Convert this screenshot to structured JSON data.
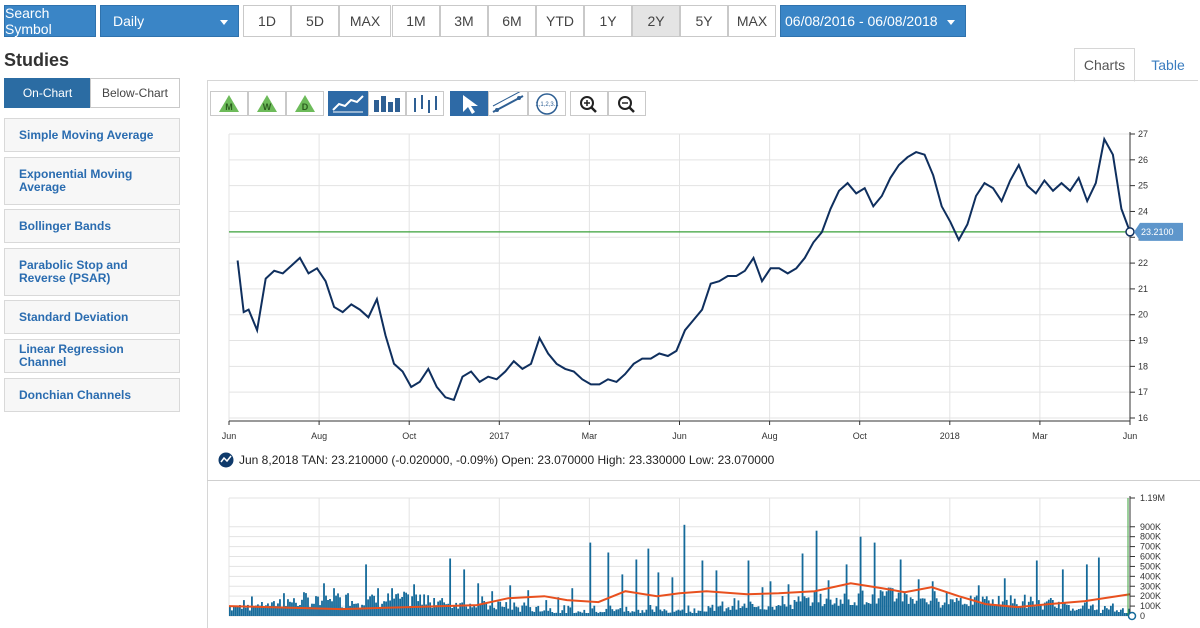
{
  "toolbar": {
    "search_label": "Search Symbol",
    "interval_label": "Daily",
    "intraday_ranges": [
      "1D",
      "5D",
      "MAX"
    ],
    "ranges": [
      "1M",
      "3M",
      "6M",
      "YTD",
      "1Y",
      "2Y",
      "5Y",
      "MAX"
    ],
    "selected_range": "2Y",
    "date_range": "06/08/2016 - 06/08/2018"
  },
  "studies": {
    "title": "Studies",
    "tabs": [
      "On-Chart",
      "Below-Chart"
    ],
    "active_tab": "On-Chart",
    "items": [
      "Simple Moving Average",
      "Exponential Moving Average",
      "Bollinger Bands",
      "Parabolic Stop and Reverse (PSAR)",
      "Standard Deviation",
      "Linear Regression Channel",
      "Donchian Channels"
    ]
  },
  "view_tabs": [
    "Charts",
    "Table"
  ],
  "active_view": "Charts",
  "chart_tools": {
    "periods": [
      "M",
      "W",
      "D"
    ],
    "chart_types": [
      "line-chart-icon",
      "bar-chart-icon",
      "ohlc-chart-icon"
    ],
    "drawing": [
      "pointer-icon",
      "trendline-icon",
      "fibonacci-icon"
    ],
    "fib_label": "1,1,2,3...",
    "zoom": [
      "zoom-in-icon",
      "zoom-out-icon"
    ]
  },
  "colors": {
    "accent": "#3a85c6",
    "price_line": "#0f2f5e",
    "last_price_line": "#3aa13a",
    "volume_bar": "#156a9a",
    "volume_avg": "#e8501e",
    "price_badge": "#5e96cb"
  },
  "info_bar": "Jun 8,2018 TAN: 23.210000 (-0.020000, -0.09%) Open: 23.070000 High: 23.330000 Low: 23.070000",
  "last_price_label": "23.2100",
  "chart_data": [
    {
      "type": "line",
      "title": "",
      "series": [
        {
          "name": "TAN",
          "x": [
            "2016-06-08",
            "2016-06-13",
            "2016-06-17",
            "2016-06-24",
            "2016-07-01",
            "2016-07-08",
            "2016-07-15",
            "2016-07-22",
            "2016-07-29",
            "2016-08-05",
            "2016-08-12",
            "2016-08-19",
            "2016-08-26",
            "2016-09-02",
            "2016-09-09",
            "2016-09-16",
            "2016-09-23",
            "2016-09-30",
            "2016-10-07",
            "2016-10-14",
            "2016-10-21",
            "2016-10-28",
            "2016-11-04",
            "2016-11-11",
            "2016-11-18",
            "2016-11-25",
            "2016-12-02",
            "2016-12-09",
            "2016-12-16",
            "2016-12-23",
            "2016-12-30",
            "2017-01-06",
            "2017-01-13",
            "2017-01-20",
            "2017-01-27",
            "2017-02-03",
            "2017-02-10",
            "2017-02-17",
            "2017-02-24",
            "2017-03-03",
            "2017-03-10",
            "2017-03-17",
            "2017-03-24",
            "2017-03-31",
            "2017-04-07",
            "2017-04-14",
            "2017-04-21",
            "2017-04-28",
            "2017-05-05",
            "2017-05-12",
            "2017-05-19",
            "2017-05-26",
            "2017-06-02",
            "2017-06-09",
            "2017-06-16",
            "2017-06-23",
            "2017-06-30",
            "2017-07-07",
            "2017-07-14",
            "2017-07-21",
            "2017-07-28",
            "2017-08-04",
            "2017-08-11",
            "2017-08-18",
            "2017-08-25",
            "2017-09-01",
            "2017-09-08",
            "2017-09-15",
            "2017-09-22",
            "2017-09-29",
            "2017-10-06",
            "2017-10-13",
            "2017-10-20",
            "2017-10-27",
            "2017-11-03",
            "2017-11-10",
            "2017-11-17",
            "2017-11-24",
            "2017-12-01",
            "2017-12-08",
            "2017-12-15",
            "2017-12-22",
            "2017-12-29",
            "2018-01-05",
            "2018-01-12",
            "2018-01-19",
            "2018-01-26",
            "2018-02-02",
            "2018-02-09",
            "2018-02-16",
            "2018-02-23",
            "2018-03-02",
            "2018-03-09",
            "2018-03-16",
            "2018-03-23",
            "2018-03-30",
            "2018-04-06",
            "2018-04-13",
            "2018-04-20",
            "2018-04-27",
            "2018-05-04",
            "2018-05-11",
            "2018-05-18",
            "2018-05-25",
            "2018-06-01",
            "2018-06-08"
          ],
          "values": [
            22.1,
            20.1,
            20.2,
            19.4,
            21.4,
            21.7,
            21.6,
            21.9,
            22.2,
            21.6,
            21.8,
            21.3,
            20.3,
            20.1,
            20.4,
            20.2,
            19.9,
            20.6,
            19.2,
            18.1,
            17.8,
            17.2,
            17.4,
            17.9,
            17.2,
            16.8,
            16.7,
            17.6,
            17.8,
            17.4,
            17.6,
            17.5,
            17.8,
            18.2,
            17.9,
            18.1,
            19.1,
            18.5,
            18.1,
            17.9,
            17.8,
            17.5,
            17.3,
            17.3,
            17.5,
            17.4,
            17.7,
            18.1,
            18.3,
            18.3,
            18.5,
            18.4,
            18.6,
            19.4,
            19.8,
            20.2,
            21.2,
            21.3,
            21.5,
            21.5,
            21.7,
            22.2,
            21.3,
            21.8,
            21.8,
            21.6,
            21.8,
            22.2,
            22.8,
            23.2,
            24.1,
            24.8,
            25.1,
            24.7,
            24.9,
            24.2,
            24.6,
            25.3,
            25.8,
            26.1,
            26.3,
            26.2,
            25.4,
            24.2,
            23.6,
            22.9,
            23.5,
            24.6,
            25.1,
            24.9,
            24.4,
            25.2,
            25.8,
            25.0,
            24.7,
            25.2,
            24.8,
            25.1,
            24.8,
            25.3,
            24.4,
            25.1,
            26.8,
            26.2,
            24.1,
            23.21
          ]
        }
      ],
      "x_ticks": [
        "Jun",
        "Aug",
        "Oct",
        "2017",
        "Mar",
        "Jun",
        "Aug",
        "Oct",
        "2018",
        "Mar",
        "Jun"
      ],
      "y_ticks": [
        "16",
        "17",
        "18",
        "19",
        "20",
        "21",
        "22",
        "23",
        "24",
        "25",
        "26",
        "27"
      ],
      "ylim": [
        16,
        27
      ],
      "last_value": 23.21,
      "grid": true
    },
    {
      "type": "bar",
      "title": "",
      "series": [
        {
          "name": "Volume",
          "values": []
        },
        {
          "name": "Volume average",
          "values": []
        }
      ],
      "y_ticks": [
        "0",
        "100K",
        "200K",
        "300K",
        "400K",
        "500K",
        "600K",
        "700K",
        "800K",
        "900K",
        "1.19M"
      ],
      "ylim": [
        0,
        1190000
      ],
      "grid": true,
      "volume_spikes": [
        [
          0.03,
          160000
        ],
        [
          0.12,
          230000
        ],
        [
          0.21,
          330000
        ],
        [
          0.23,
          280000
        ],
        [
          0.26,
          230000
        ],
        [
          0.3,
          520000
        ],
        [
          0.33,
          280000
        ],
        [
          0.36,
          280000
        ],
        [
          0.41,
          320000
        ],
        [
          0.44,
          210000
        ],
        [
          0.49,
          580000
        ],
        [
          0.52,
          470000
        ],
        [
          0.55,
          330000
        ],
        [
          0.58,
          250000
        ],
        [
          0.62,
          310000
        ],
        [
          0.66,
          260000
        ],
        [
          0.7,
          160000
        ],
        [
          0.73,
          190000
        ],
        [
          0.76,
          280000
        ],
        [
          0.8,
          740000
        ],
        [
          0.84,
          640000
        ],
        [
          0.87,
          420000
        ],
        [
          0.9,
          570000
        ],
        [
          0.93,
          680000
        ],
        [
          0.95,
          440000
        ],
        [
          0.98,
          390000
        ],
        [
          1.01,
          920000
        ],
        [
          1.05,
          560000
        ],
        [
          1.08,
          460000
        ],
        [
          1.12,
          180000
        ],
        [
          1.15,
          560000
        ],
        [
          1.18,
          290000
        ],
        [
          1.2,
          350000
        ],
        [
          1.24,
          320000
        ],
        [
          1.27,
          630000
        ],
        [
          1.3,
          860000
        ],
        [
          1.33,
          360000
        ],
        [
          1.37,
          520000
        ],
        [
          1.4,
          800000
        ],
        [
          1.43,
          740000
        ],
        [
          1.47,
          280000
        ],
        [
          1.49,
          570000
        ],
        [
          1.53,
          370000
        ],
        [
          1.56,
          350000
        ],
        [
          1.61,
          140000
        ],
        [
          1.66,
          310000
        ],
        [
          1.72,
          380000
        ],
        [
          1.79,
          560000
        ],
        [
          1.85,
          470000
        ],
        [
          1.9,
          520000
        ],
        [
          1.93,
          590000
        ]
      ],
      "avg_points": [
        [
          0.0,
          100000
        ],
        [
          0.25,
          70000
        ],
        [
          0.4,
          90000
        ],
        [
          0.55,
          110000
        ],
        [
          0.62,
          180000
        ],
        [
          0.7,
          200000
        ],
        [
          0.75,
          160000
        ],
        [
          0.82,
          140000
        ],
        [
          0.88,
          250000
        ],
        [
          0.95,
          200000
        ],
        [
          1.0,
          230000
        ],
        [
          1.06,
          250000
        ],
        [
          1.15,
          220000
        ],
        [
          1.22,
          230000
        ],
        [
          1.3,
          250000
        ],
        [
          1.38,
          330000
        ],
        [
          1.45,
          280000
        ],
        [
          1.5,
          240000
        ],
        [
          1.56,
          290000
        ],
        [
          1.62,
          200000
        ],
        [
          1.68,
          120000
        ],
        [
          1.75,
          90000
        ],
        [
          1.82,
          120000
        ],
        [
          1.9,
          150000
        ],
        [
          2.0,
          220000
        ]
      ]
    }
  ]
}
